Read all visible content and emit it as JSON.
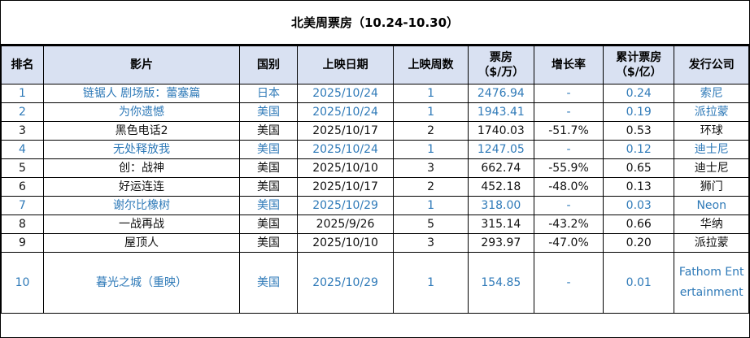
{
  "title": "北美周票房（10.24-10.30）",
  "headers": [
    "排名",
    "影片",
    "国别",
    "上映日期",
    "上映周数",
    "票房\n（$/万）",
    "增长率",
    "累计票房\n（$/亿）",
    "发行公司"
  ],
  "header_lines": {
    "gross_line1": "票房",
    "gross_line2": "（$/万）",
    "total_line1": "累计票房",
    "total_line2": "（$/亿）"
  },
  "rows": [
    {
      "rank": "1",
      "film": "链锯人 剧场版：蕾塞篇",
      "country": "日本",
      "date": "2025/10/24",
      "weeks": "1",
      "gross": "2476.94",
      "change": "-",
      "total": "0.24",
      "distributor": "索尼",
      "is_new": true
    },
    {
      "rank": "2",
      "film": "为你遗憾",
      "country": "美国",
      "date": "2025/10/24",
      "weeks": "1",
      "gross": "1943.41",
      "change": "-",
      "total": "0.19",
      "distributor": "派拉蒙",
      "is_new": true
    },
    {
      "rank": "3",
      "film": "黑色电话2",
      "country": "美国",
      "date": "2025/10/17",
      "weeks": "2",
      "gross": "1740.03",
      "change": "-51.7%",
      "total": "0.53",
      "distributor": "环球",
      "is_new": false
    },
    {
      "rank": "4",
      "film": "无处释放我",
      "country": "美国",
      "date": "2025/10/24",
      "weeks": "1",
      "gross": "1247.05",
      "change": "-",
      "total": "0.12",
      "distributor": "迪士尼",
      "is_new": true
    },
    {
      "rank": "5",
      "film": "创：战神",
      "country": "美国",
      "date": "2025/10/10",
      "weeks": "3",
      "gross": "662.74",
      "change": "-55.9%",
      "total": "0.65",
      "distributor": "迪士尼",
      "is_new": false
    },
    {
      "rank": "6",
      "film": "好运连连",
      "country": "美国",
      "date": "2025/10/17",
      "weeks": "2",
      "gross": "452.18",
      "change": "-48.0%",
      "total": "0.13",
      "distributor": "狮门",
      "is_new": false
    },
    {
      "rank": "7",
      "film": "谢尔比橡树",
      "country": "美国",
      "date": "2025/10/29",
      "weeks": "1",
      "gross": "318.00",
      "change": "-",
      "total": "0.03",
      "distributor": "Neon",
      "is_new": true
    },
    {
      "rank": "8",
      "film": "一战再战",
      "country": "美国",
      "date": "2025/9/26",
      "weeks": "5",
      "gross": "315.14",
      "change": "-43.2%",
      "total": "0.66",
      "distributor": "华纳",
      "is_new": false
    },
    {
      "rank": "9",
      "film": "屋顶人",
      "country": "美国",
      "date": "2025/10/10",
      "weeks": "3",
      "gross": "293.97",
      "change": "-47.0%",
      "total": "0.20",
      "distributor": "派拉蒙",
      "is_new": false
    },
    {
      "rank": "10",
      "film": "暮光之城（重映）",
      "country": "美国",
      "date": "2025/10/29",
      "weeks": "1",
      "gross": "154.85",
      "change": "-",
      "total": "0.01",
      "distributor": "Fathom Entertainment",
      "is_new": true
    }
  ],
  "colors": {
    "header_bg": "#d9e1f2",
    "new_release_text": "#2f7ab8",
    "border": "#000000"
  }
}
